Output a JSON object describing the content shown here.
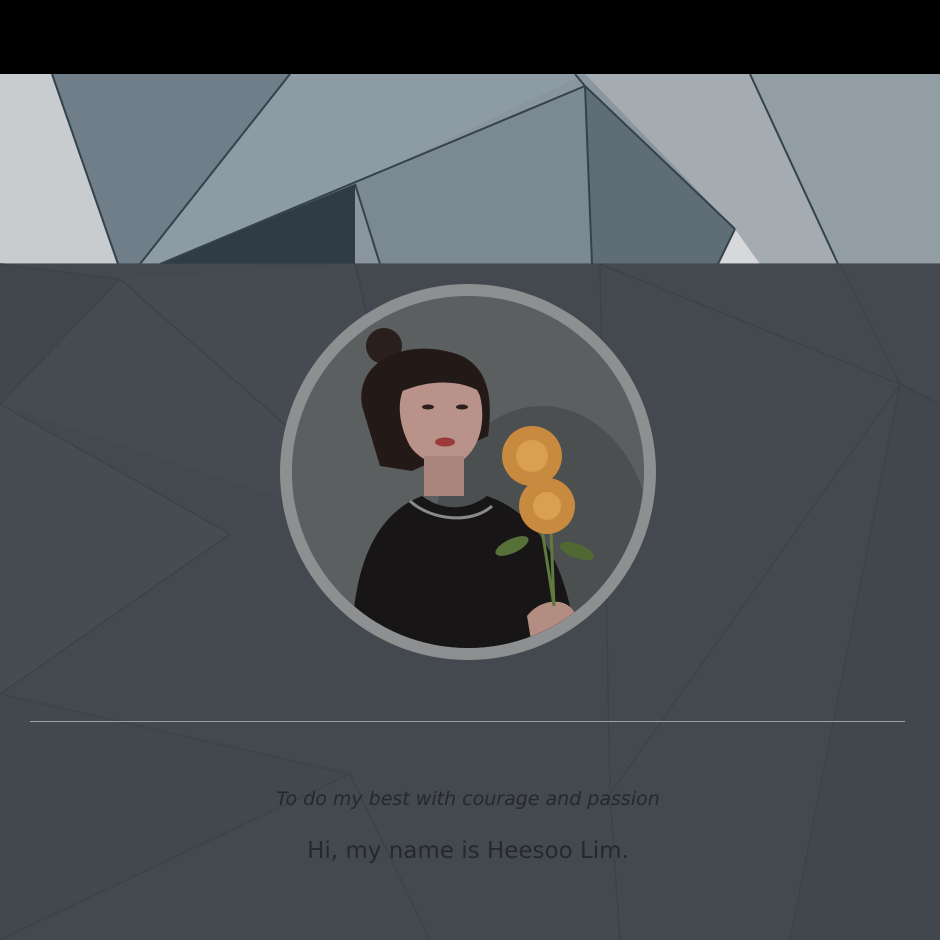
{
  "profile": {
    "tagline": "To do my best with courage and passion",
    "intro": "Hi, my name is Heesoo Lim."
  },
  "icons": {
    "avatar": "profile-photo-woman-holding-flowers",
    "background": "geometric-architecture-background"
  },
  "colors": {
    "background_overlay": "#4a4f55",
    "ring": "#8d8f91",
    "text": "#25282c",
    "divider": "#9ea2a6"
  }
}
